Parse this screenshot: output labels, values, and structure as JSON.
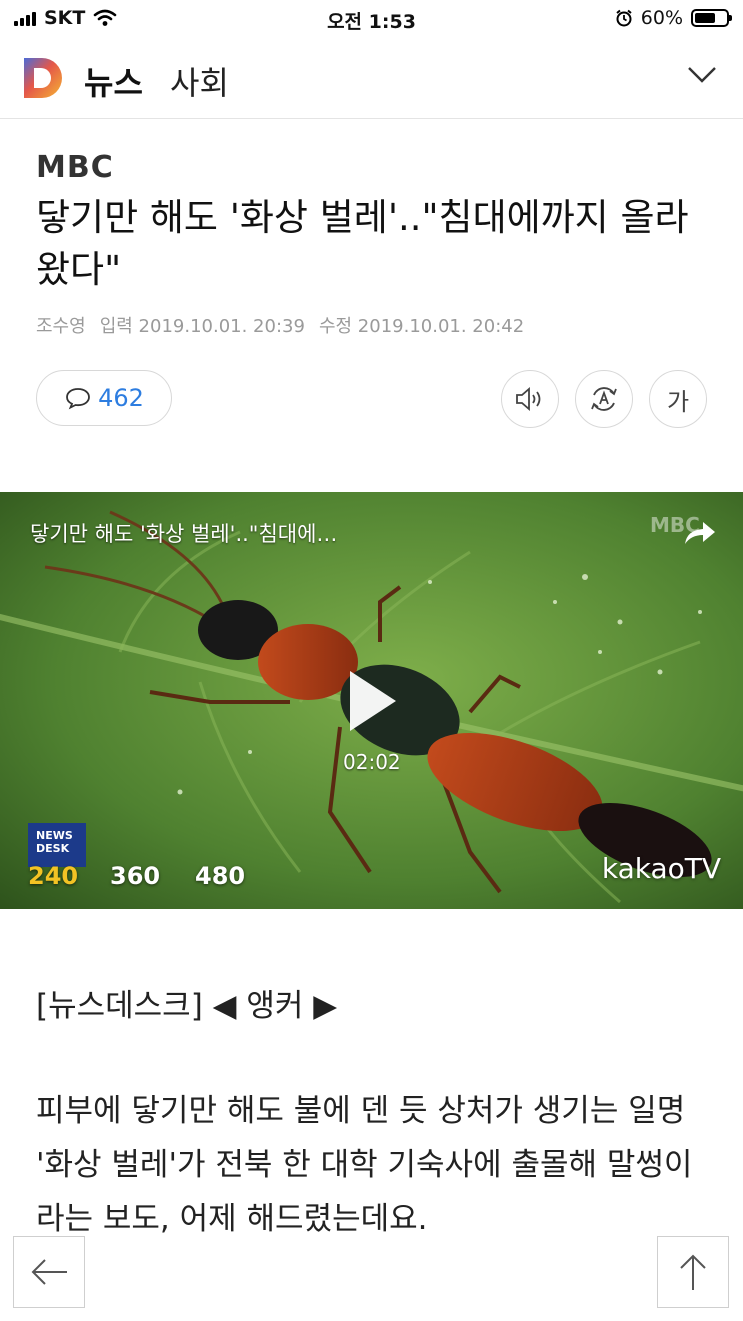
{
  "status_bar": {
    "carrier": "SKT",
    "time": "오전 1:53",
    "battery": "60%"
  },
  "app_bar": {
    "app_name": "뉴스",
    "section": "사회"
  },
  "article": {
    "press": "MBC",
    "headline": "닿기만 해도 '화상 벌레'..\"침대에까지 올라왔다\"",
    "reporter": "조수영",
    "input_label": "입력",
    "input_time": "2019.10.01. 20:39",
    "edit_label": "수정",
    "edit_time": "2019.10.01. 20:42",
    "comment_count": "462",
    "font_button_label": "가"
  },
  "video": {
    "title": "닿기만 해도 '화상 벌레'..\"침대에…",
    "duration": "02:02",
    "badge": "NEWS DESK",
    "qualities": [
      "240",
      "360",
      "480"
    ],
    "selected_quality": "240",
    "provider": "kakaoTV"
  },
  "body": {
    "lead": "[뉴스데스크] ◀ 앵커 ▶",
    "paragraph": "피부에 닿기만 해도 불에 덴 듯 상처가 생기는 일명 '화상 벌레'가 전북 한 대학 기숙사에 출몰해 말썽이라는 보도, 어제 해드렸는데요."
  },
  "colors": {
    "accent_blue": "#2d7de0",
    "quality_selected": "#f3c324"
  }
}
